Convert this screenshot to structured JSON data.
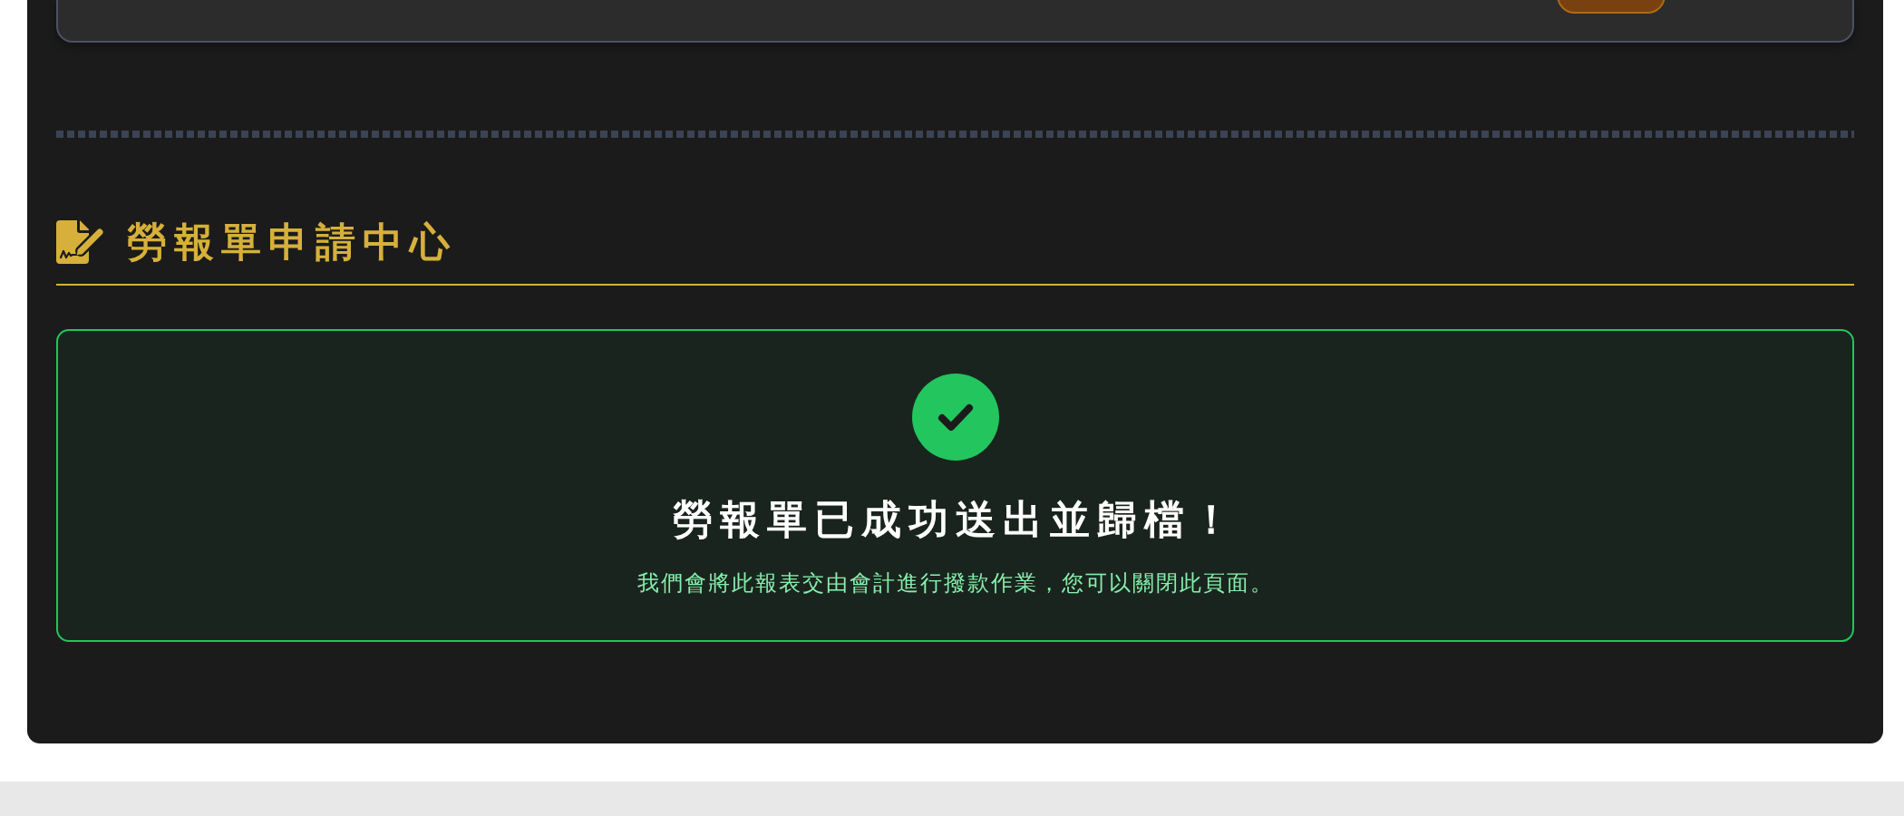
{
  "section": {
    "title": "勞報單申請中心"
  },
  "result": {
    "kind": "success",
    "title": "勞報單已成功送出並歸檔！",
    "message": "我們會將此報表交由會計進行撥款作業，您可以關閉此頁面。"
  }
}
